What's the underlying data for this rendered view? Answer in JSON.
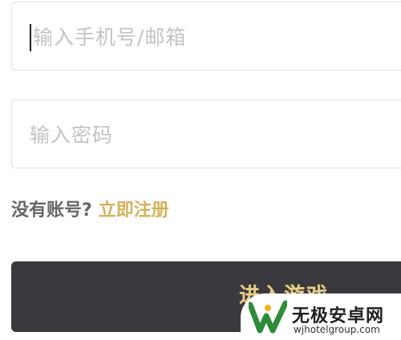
{
  "login": {
    "phone_placeholder": "输入手机号/邮箱",
    "password_placeholder": "输入密码",
    "no_account": "没有账号?",
    "register_link": "立即注册",
    "enter_button": "进入游戏"
  },
  "watermark": {
    "title": "无极安卓网",
    "url": "wjhotelgroup.com",
    "logo_icon": "w-logo-icon"
  },
  "colors": {
    "accent": "#d4b15a",
    "button_bg": "#3a3a3e",
    "button_text": "#e8cd86",
    "logo_green": "#2e8b3a"
  }
}
